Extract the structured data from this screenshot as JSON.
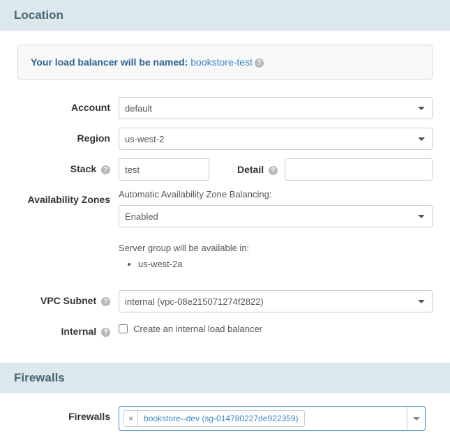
{
  "sections": {
    "location_title": "Location",
    "firewalls_title": "Firewalls"
  },
  "callout": {
    "prefix": "Your load balancer will be named:",
    "name": "bookstore-test"
  },
  "labels": {
    "account": "Account",
    "region": "Region",
    "stack": "Stack",
    "detail": "Detail",
    "availability_zones": "Availability Zones",
    "vpc_subnet": "VPC Subnet",
    "internal": "Internal",
    "firewalls": "Firewalls"
  },
  "fields": {
    "account": {
      "value": "default"
    },
    "region": {
      "value": "us-west-2"
    },
    "stack": {
      "value": "test"
    },
    "detail": {
      "value": ""
    },
    "az_mode_label": "Automatic Availability Zone Balancing:",
    "az_mode": {
      "value": "Enabled"
    },
    "server_group_note": "Server group will be available in:",
    "zones": [
      "us-west-2a"
    ],
    "vpc_subnet": {
      "value": "internal (vpc-08e215071274f2822)"
    },
    "internal_checkbox_label": "Create an internal load balancer",
    "internal_checked": false,
    "firewalls_selected": [
      {
        "label": "bookstore--dev (sg-014780227de922359)"
      }
    ]
  },
  "help_glyph": "?"
}
